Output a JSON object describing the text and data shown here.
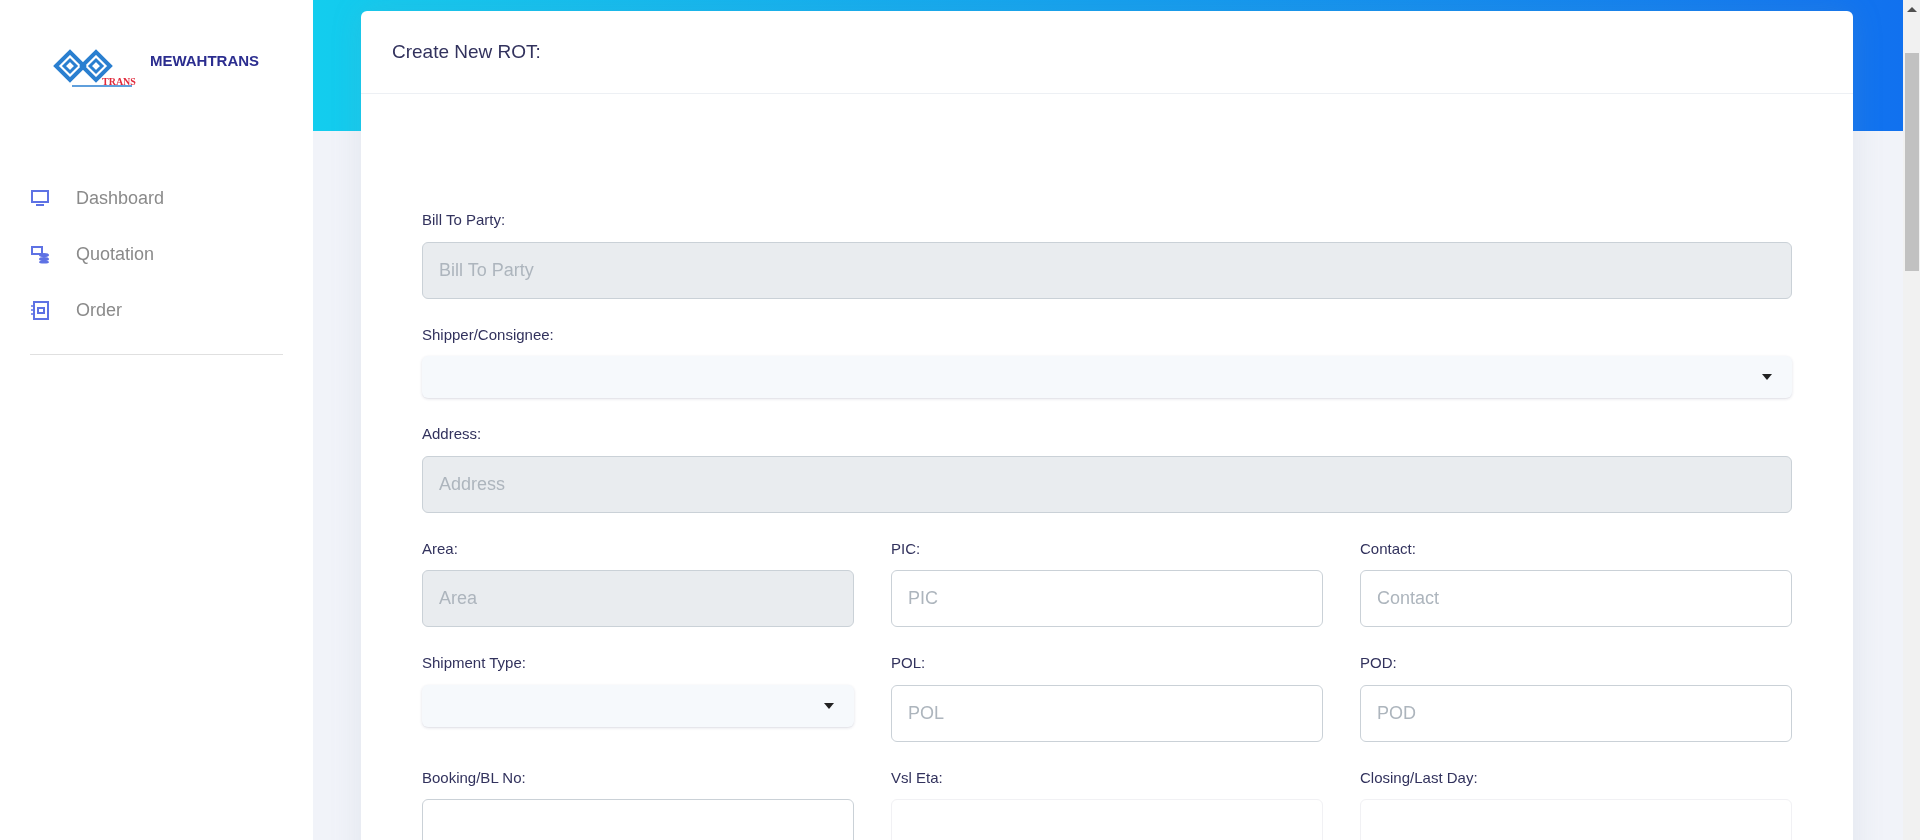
{
  "logo": {
    "name": "MEWAHTRANS",
    "sub": "TRANS"
  },
  "sidebar": {
    "items": [
      {
        "label": "Dashboard",
        "kind": "monitor"
      },
      {
        "label": "Quotation",
        "kind": "quote"
      },
      {
        "label": "Order",
        "kind": "notebook"
      }
    ]
  },
  "card": {
    "title": "Create New ROT:"
  },
  "form": {
    "rows": [
      [
        {
          "kind": "input",
          "label": "Bill To Party:",
          "placeholder": "Bill To Party",
          "disabled": true
        }
      ],
      [
        {
          "kind": "select",
          "label": "Shipper/Consignee:"
        }
      ],
      [
        {
          "kind": "input",
          "label": "Address:",
          "placeholder": "Address",
          "disabled": true
        }
      ],
      [
        {
          "kind": "input",
          "label": "Area:",
          "placeholder": "Area",
          "disabled": true
        },
        {
          "kind": "input",
          "label": "PIC:",
          "placeholder": "PIC",
          "disabled": false
        },
        {
          "kind": "input",
          "label": "Contact:",
          "placeholder": "Contact",
          "disabled": false
        }
      ],
      [
        {
          "kind": "select",
          "label": "Shipment Type:"
        },
        {
          "kind": "input",
          "label": "POL:",
          "placeholder": "POL",
          "disabled": false
        },
        {
          "kind": "input",
          "label": "POD:",
          "placeholder": "POD",
          "disabled": false
        }
      ],
      [
        {
          "kind": "input",
          "label": "Booking/BL No:",
          "disabled": false
        },
        {
          "kind": "faint",
          "label": "Vsl Eta:"
        },
        {
          "kind": "faint",
          "label": "Closing/Last Day:"
        }
      ]
    ]
  }
}
